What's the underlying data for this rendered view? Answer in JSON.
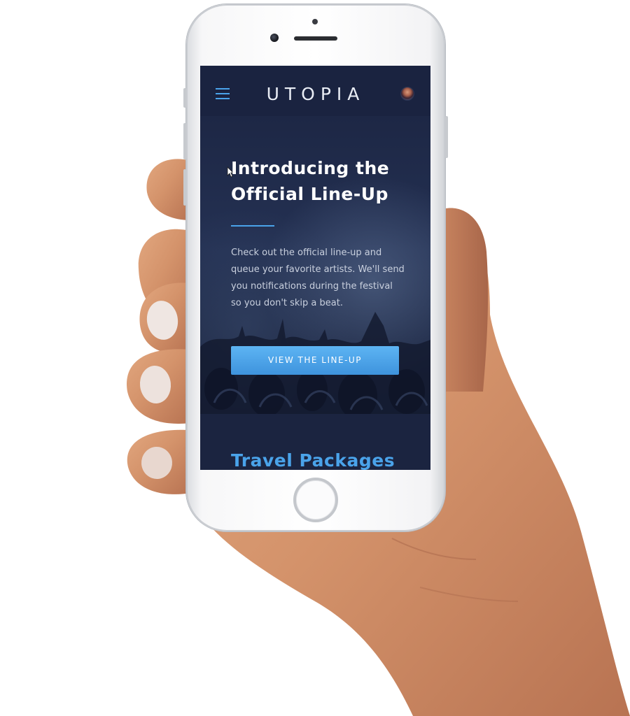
{
  "app": {
    "logo_text": "UTOPIA"
  },
  "header": {
    "menu_icon": "hamburger-icon",
    "avatar_icon": "user-avatar"
  },
  "hero": {
    "title": "Introducing the Official Line-Up",
    "body": "Check out the official line-up and queue your favorite artists. We'll send you notifications during the festival so you don't skip a beat.",
    "cta_label": "VIEW THE LINE-UP"
  },
  "sections": {
    "travel_title": "Travel Packages"
  },
  "colors": {
    "accent": "#4aa3ea",
    "background": "#1b2440",
    "cta_gradient_top": "#5db4f3",
    "cta_gradient_bottom": "#3e93dd"
  }
}
